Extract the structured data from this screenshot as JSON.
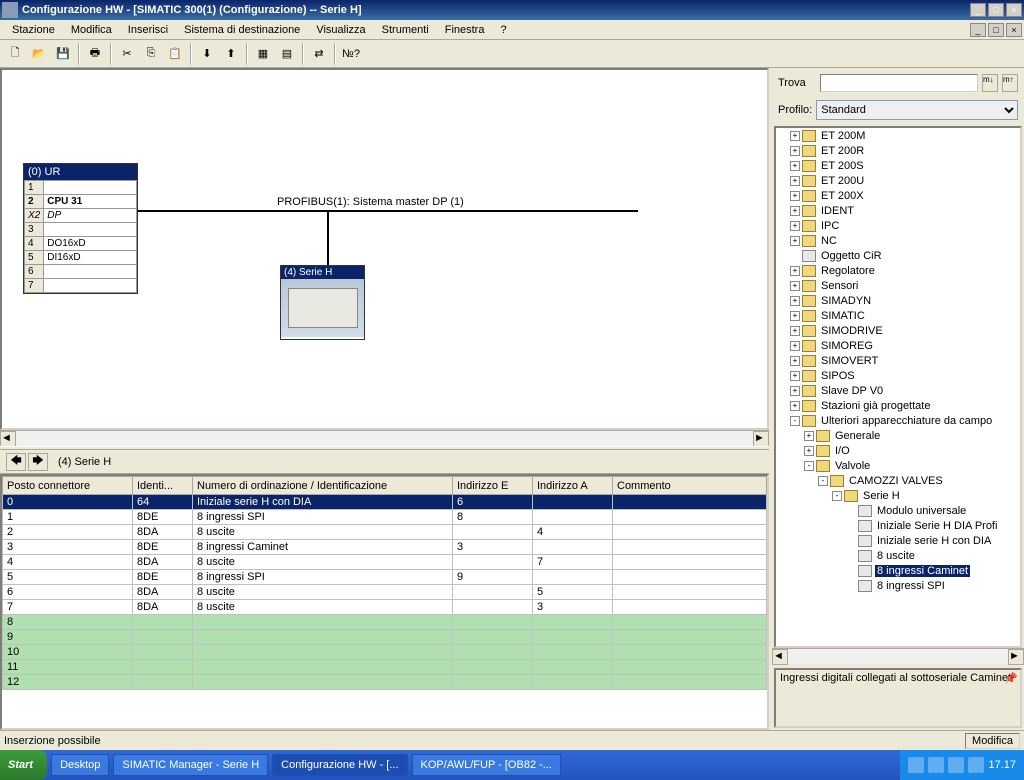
{
  "title": "Configurazione HW - [SIMATIC 300(1) (Configurazione) -- Serie H]",
  "menu": [
    "Stazione",
    "Modifica",
    "Inserisci",
    "Sistema di destinazione",
    "Visualizza",
    "Strumenti",
    "Finestra",
    "?"
  ],
  "rack": {
    "title": "(0) UR",
    "rows": [
      {
        "slot": "1",
        "name": ""
      },
      {
        "slot": "2",
        "name": "CPU 31",
        "bold": true
      },
      {
        "slot": "X2",
        "name": "DP",
        "italic": true
      },
      {
        "slot": "3",
        "name": ""
      },
      {
        "slot": "4",
        "name": "DO16xD"
      },
      {
        "slot": "5",
        "name": "DI16xD"
      },
      {
        "slot": "6",
        "name": ""
      },
      {
        "slot": "7",
        "name": ""
      }
    ]
  },
  "bus_label": "PROFIBUS(1): Sistema master DP (1)",
  "device_title": "(4) Serie H",
  "detail": {
    "title": "(4)  Serie H",
    "columns": [
      "Posto connettore",
      "Identi...",
      "Numero di ordinazione / Identificazione",
      "Indirizzo E",
      "Indirizzo A",
      "Commento"
    ],
    "rows": [
      {
        "slot": "0",
        "id": "64",
        "ord": "Iniziale serie H con DIA",
        "ie": "6",
        "ia": "",
        "sel": true
      },
      {
        "slot": "1",
        "id": "8DE",
        "ord": "8 ingressi SPI",
        "ie": "8",
        "ia": ""
      },
      {
        "slot": "2",
        "id": "8DA",
        "ord": "8 uscite",
        "ie": "",
        "ia": "4"
      },
      {
        "slot": "3",
        "id": "8DE",
        "ord": "8 ingressi Caminet",
        "ie": "3",
        "ia": ""
      },
      {
        "slot": "4",
        "id": "8DA",
        "ord": "8 uscite",
        "ie": "",
        "ia": "7"
      },
      {
        "slot": "5",
        "id": "8DE",
        "ord": "8 ingressi SPI",
        "ie": "9",
        "ia": ""
      },
      {
        "slot": "6",
        "id": "8DA",
        "ord": "8 uscite",
        "ie": "",
        "ia": "5"
      },
      {
        "slot": "7",
        "id": "8DA",
        "ord": "8 uscite",
        "ie": "",
        "ia": "3"
      },
      {
        "slot": "8",
        "empty": true
      },
      {
        "slot": "9",
        "empty": true
      },
      {
        "slot": "10",
        "empty": true
      },
      {
        "slot": "11",
        "empty": true
      },
      {
        "slot": "12",
        "empty": true
      }
    ]
  },
  "search_label": "Trova",
  "profile_label": "Profilo:",
  "profile_value": "Standard",
  "tree": [
    {
      "d": 1,
      "exp": "+",
      "label": "ET 200M"
    },
    {
      "d": 1,
      "exp": "+",
      "label": "ET 200R"
    },
    {
      "d": 1,
      "exp": "+",
      "label": "ET 200S"
    },
    {
      "d": 1,
      "exp": "+",
      "label": "ET 200U"
    },
    {
      "d": 1,
      "exp": "+",
      "label": "ET 200X"
    },
    {
      "d": 1,
      "exp": "+",
      "label": "IDENT"
    },
    {
      "d": 1,
      "exp": "+",
      "label": "IPC"
    },
    {
      "d": 1,
      "exp": "+",
      "label": "NC"
    },
    {
      "d": 1,
      "exp": "",
      "label": "Oggetto CiR",
      "file": true
    },
    {
      "d": 1,
      "exp": "+",
      "label": "Regolatore"
    },
    {
      "d": 1,
      "exp": "+",
      "label": "Sensori"
    },
    {
      "d": 1,
      "exp": "+",
      "label": "SIMADYN"
    },
    {
      "d": 1,
      "exp": "+",
      "label": "SIMATIC"
    },
    {
      "d": 1,
      "exp": "+",
      "label": "SIMODRIVE"
    },
    {
      "d": 1,
      "exp": "+",
      "label": "SIMOREG"
    },
    {
      "d": 1,
      "exp": "+",
      "label": "SIMOVERT"
    },
    {
      "d": 1,
      "exp": "+",
      "label": "SIPOS"
    },
    {
      "d": 1,
      "exp": "+",
      "label": "Slave DP V0"
    },
    {
      "d": 1,
      "exp": "+",
      "label": "Stazioni già progettate"
    },
    {
      "d": 1,
      "exp": "-",
      "label": "Ulteriori apparecchiature da campo"
    },
    {
      "d": 2,
      "exp": "+",
      "label": "Generale"
    },
    {
      "d": 2,
      "exp": "+",
      "label": "I/O"
    },
    {
      "d": 2,
      "exp": "-",
      "label": "Valvole"
    },
    {
      "d": 3,
      "exp": "-",
      "label": "CAMOZZI VALVES"
    },
    {
      "d": 4,
      "exp": "-",
      "label": "Serie H"
    },
    {
      "d": 5,
      "exp": "",
      "label": "Modulo universale",
      "file": true
    },
    {
      "d": 5,
      "exp": "",
      "label": "Iniziale Serie H DIA Profi",
      "file": true
    },
    {
      "d": 5,
      "exp": "",
      "label": "Iniziale serie H con DIA",
      "file": true
    },
    {
      "d": 5,
      "exp": "",
      "label": "8 uscite",
      "file": true
    },
    {
      "d": 5,
      "exp": "",
      "label": "8 ingressi Caminet",
      "file": true,
      "sel": true
    },
    {
      "d": 5,
      "exp": "",
      "label": "8 ingressi SPI",
      "file": true
    }
  ],
  "desc": "Ingressi digitali collegati al sottoseriale Caminet",
  "status_text": "Inserzione possibile",
  "status_mod": "Modifica",
  "taskbar": {
    "start": "Start",
    "items": [
      "Desktop",
      "SIMATIC Manager - Serie H",
      "Configurazione HW - [...",
      "KOP/AWL/FUP  - [OB82 -..."
    ],
    "active_index": 2,
    "time": "17.17"
  }
}
